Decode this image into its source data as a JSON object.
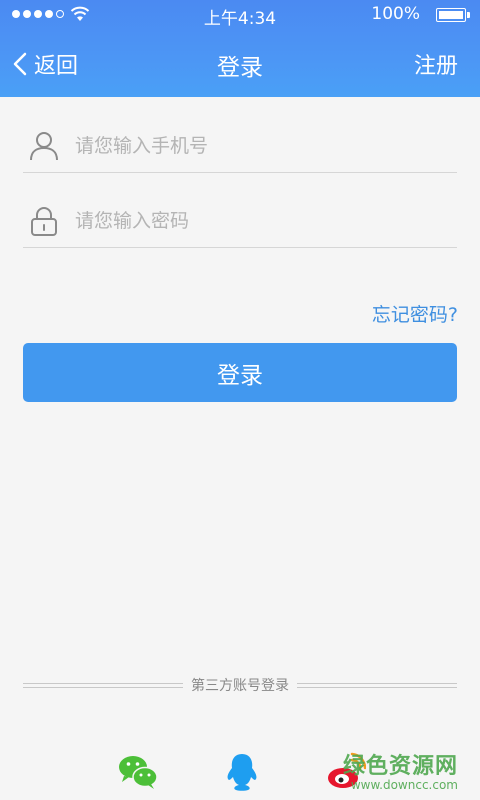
{
  "status": {
    "time": "上午4:34",
    "battery": "100%"
  },
  "nav": {
    "back_label": "返回",
    "title": "登录",
    "register_label": "注册"
  },
  "form": {
    "phone_placeholder": "请您输入手机号",
    "password_placeholder": "请您输入密码",
    "forgot_label": "忘记密码?",
    "login_label": "登录"
  },
  "third_party": {
    "label": "第三方账号登录",
    "icons": [
      "wechat-icon",
      "qq-icon",
      "weibo-icon"
    ]
  },
  "watermark": {
    "main": "绿色资源网",
    "url": "www.downcc.com"
  },
  "colors": {
    "header": "#4c96f5",
    "button": "#4298ef",
    "link": "#3f8fe0",
    "wechat": "#4cbf38",
    "qq": "#1e9ef0",
    "weibo": "#e6162d"
  }
}
